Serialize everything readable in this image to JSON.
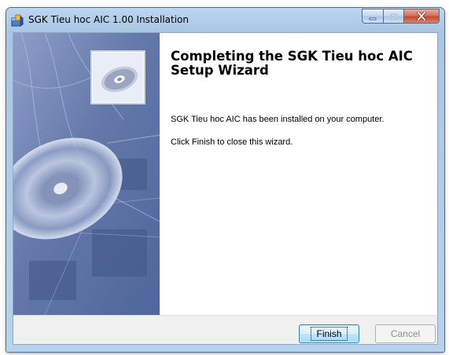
{
  "window": {
    "title": "SGK Tieu hoc AIC 1.00 Installation",
    "app_icon": "installer-box-icon"
  },
  "caption_buttons": {
    "minimize_icon": "minimize-icon",
    "maximize_icon": "maximize-icon",
    "close_icon": "close-icon"
  },
  "wizard": {
    "heading": "Completing the SGK Tieu hoc AIC Setup Wizard",
    "message_installed": "SGK Tieu hoc AIC has been installed on your computer.",
    "message_finish": "Click Finish to close this wizard."
  },
  "buttons": {
    "finish": "Finish",
    "cancel": "Cancel"
  },
  "colors": {
    "sidebar": "#6d80ae",
    "footer": "#f0f0f0",
    "close_button": "#c24b2f"
  }
}
